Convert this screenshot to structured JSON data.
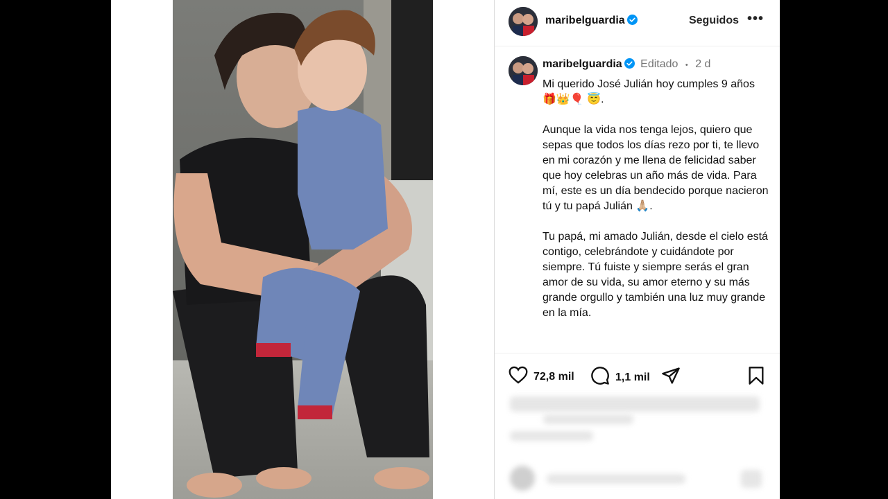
{
  "post": {
    "username": "maribelguardia",
    "follow_label": "Seguidos",
    "more_label": "•••",
    "edited_label": "Editado",
    "separator": "•",
    "time_ago": "2 d",
    "caption_paragraphs": [
      "Mi querido José Julián hoy cumples 9 años 🎁👑🎈 😇.",
      "Aunque la vida nos tenga lejos, quiero que sepas que todos los días rezo por ti, te llevo en mi corazón y me llena de felicidad saber que hoy celebras un año más de vida. Para mí, este es un día bendecido porque nacieron tú y tu papá Julián 🙏🏼.",
      "Tu papá, mi amado Julián, desde el cielo está contigo, celebrándote y cuidándote por siempre. Tú fuiste y siempre serás el gran amor de su vida, su amor eterno y su más grande orgullo y también una luz muy grande en la mía."
    ],
    "likes": "72,8 mil",
    "comments": "1,1 mil"
  },
  "icons": [
    "verified-badge-icon",
    "heart-icon",
    "comment-icon",
    "share-icon",
    "bookmark-icon",
    "more-icon"
  ],
  "colors": {
    "verified": "#0095f6",
    "text": "#262626",
    "meta": "#737373",
    "background": "#000000"
  }
}
